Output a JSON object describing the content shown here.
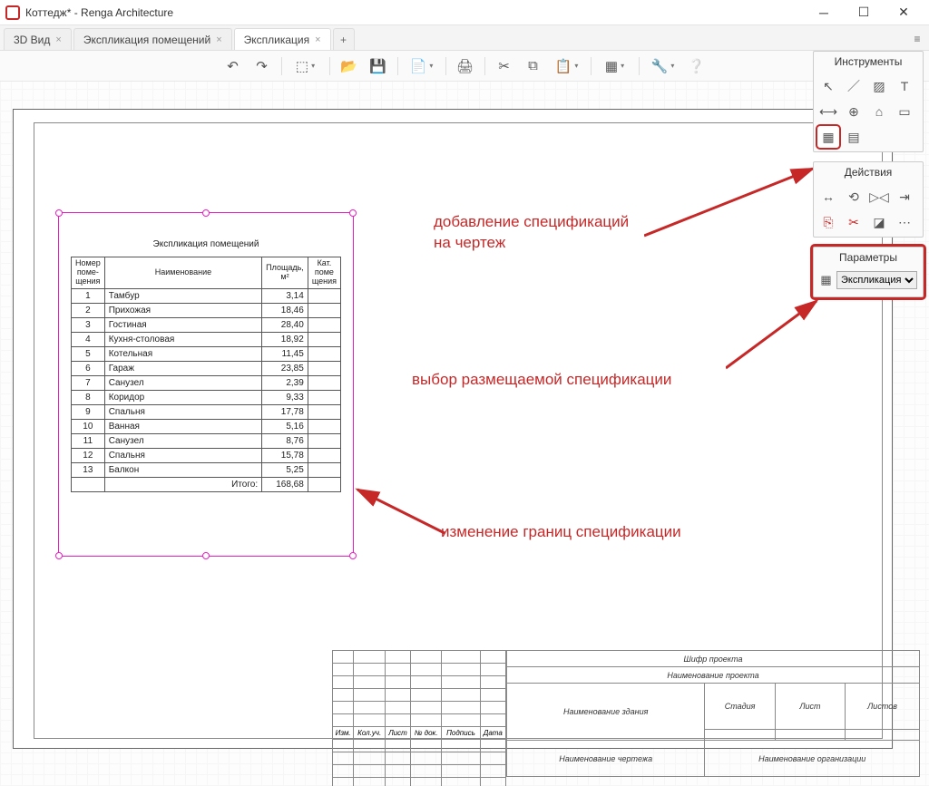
{
  "window": {
    "title": "Коттедж* - Renga Architecture"
  },
  "tabs": [
    {
      "label": "3D Вид",
      "closable": true,
      "active": false
    },
    {
      "label": "Экспликация помещений",
      "closable": true,
      "active": false
    },
    {
      "label": "Экспликация",
      "closable": true,
      "active": true
    }
  ],
  "spec": {
    "title": "Экспликация помещений",
    "headers": {
      "num": "Номер\nпоме-\nщения",
      "name": "Наименование",
      "area": "Площадь,\nм²",
      "cat": "Кат.\nпоме\nщения"
    },
    "rows": [
      {
        "num": "1",
        "name": "Тамбур",
        "area": "3,14"
      },
      {
        "num": "2",
        "name": "Прихожая",
        "area": "18,46"
      },
      {
        "num": "3",
        "name": "Гостиная",
        "area": "28,40"
      },
      {
        "num": "4",
        "name": "Кухня-столовая",
        "area": "18,92"
      },
      {
        "num": "5",
        "name": "Котельная",
        "area": "11,45"
      },
      {
        "num": "6",
        "name": "Гараж",
        "area": "23,85"
      },
      {
        "num": "7",
        "name": "Санузел",
        "area": "2,39"
      },
      {
        "num": "8",
        "name": "Коридор",
        "area": "9,33"
      },
      {
        "num": "9",
        "name": "Спальня",
        "area": "17,78"
      },
      {
        "num": "10",
        "name": "Ванная",
        "area": "5,16"
      },
      {
        "num": "11",
        "name": "Санузел",
        "area": "8,76"
      },
      {
        "num": "12",
        "name": "Спальня",
        "area": "15,78"
      },
      {
        "num": "13",
        "name": "Балкон",
        "area": "5,25"
      }
    ],
    "total_label": "Итого:",
    "total_value": "168,68"
  },
  "annotations": {
    "add_spec": "добавление спецификаций\nна чертеж",
    "choose_spec": "выбор размещаемой спецификации",
    "resize_spec": "изменение границ спецификации"
  },
  "panels": {
    "tools_title": "Инструменты",
    "actions_title": "Действия",
    "params_title": "Параметры",
    "param_select": "Экспликация"
  },
  "titleblock": {
    "code": "Шифр проекта",
    "project": "Наименование проекта",
    "building": "Наименование здания",
    "drawing": "Наименование чертежа",
    "org": "Наименование организации",
    "stage": "Стадия",
    "sheet": "Лист",
    "sheets": "Листов",
    "side_labels": [
      "Изм.",
      "Кол.уч.",
      "Лист",
      "№ док.",
      "Подпись",
      "Дата"
    ]
  }
}
